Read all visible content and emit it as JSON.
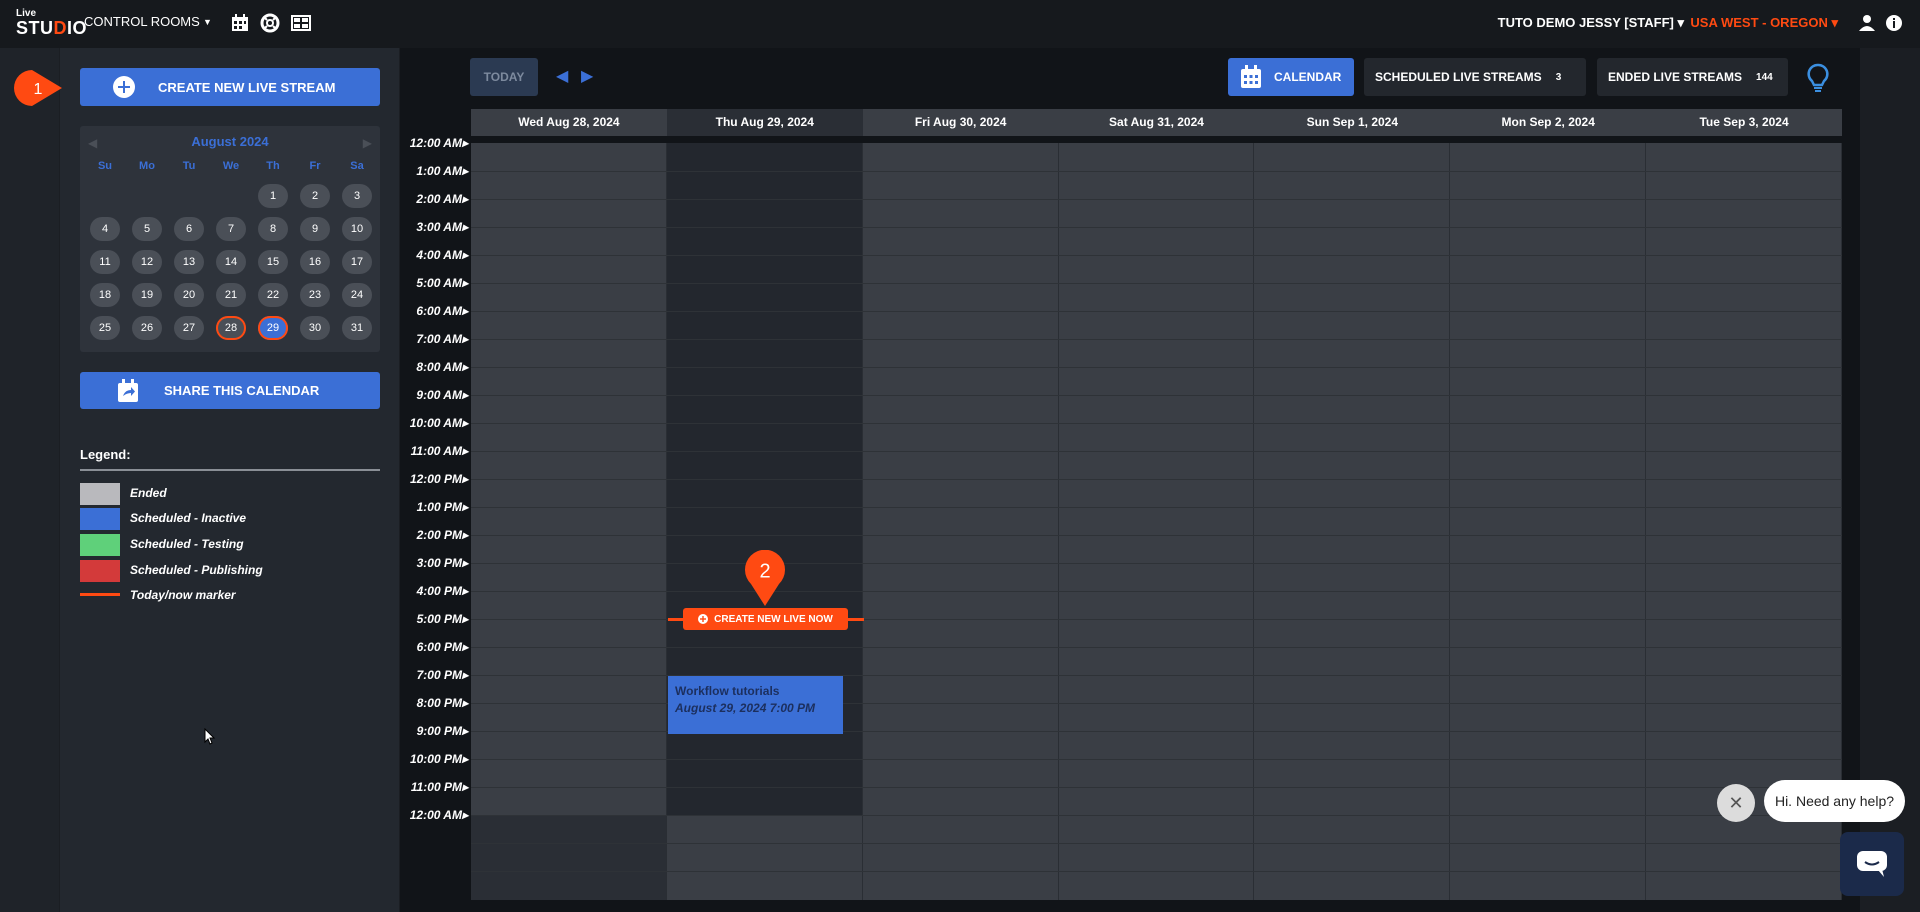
{
  "app": {
    "logo_top": "Live",
    "logo_main": "STU",
    "logo_dot": "D",
    "logo_end": "IO"
  },
  "topbar": {
    "control_rooms": "CONTROL ROOMS",
    "icons": [
      "calendar-icon",
      "lifebuoy-icon",
      "layout-icon"
    ],
    "user": "TUTO DEMO JESSY [STAFF] ▾",
    "region": "USA WEST - OREGON ▾"
  },
  "sidebar": {
    "create_button": "CREATE NEW LIVE STREAM",
    "marker_1": "1",
    "mini_calendar": {
      "month": "August 2024",
      "weekdays": [
        "Su",
        "Mo",
        "Tu",
        "We",
        "Th",
        "Fr",
        "Sa"
      ],
      "weeks": [
        [
          "",
          "",
          "",
          "",
          "1",
          "2",
          "3"
        ],
        [
          "4",
          "5",
          "6",
          "7",
          "8",
          "9",
          "10"
        ],
        [
          "11",
          "12",
          "13",
          "14",
          "15",
          "16",
          "17"
        ],
        [
          "18",
          "19",
          "20",
          "21",
          "22",
          "23",
          "24"
        ],
        [
          "25",
          "26",
          "27",
          "28",
          "29",
          "30",
          "31"
        ]
      ],
      "highlighted": "28",
      "selected": "29"
    },
    "share_button": "SHARE THIS CALENDAR",
    "legend": {
      "title": "Legend:",
      "items": [
        {
          "label": "Ended",
          "color": "#b9b9bd"
        },
        {
          "label": "Scheduled - Inactive",
          "color": "#3b6fd6"
        },
        {
          "label": "Scheduled - Testing",
          "color": "#5fd07a"
        },
        {
          "label": "Scheduled - Publishing",
          "color": "#d33a3a"
        },
        {
          "label": "Today/now marker",
          "color": "#ff4a12"
        }
      ]
    }
  },
  "toolbar": {
    "today": "TODAY",
    "calendar": "CALENDAR",
    "scheduled": "SCHEDULED LIVE STREAMS",
    "scheduled_count": "3",
    "ended": "ENDED LIVE STREAMS",
    "ended_count": "144"
  },
  "calendar": {
    "days": [
      "Wed Aug 28, 2024",
      "Thu Aug 29, 2024",
      "Fri Aug 30, 2024",
      "Sat Aug 31, 2024",
      "Sun Sep 1, 2024",
      "Mon Sep 2, 2024",
      "Tue Sep 3, 2024"
    ],
    "times": [
      "12:00 AM",
      "1:00 AM",
      "2:00 AM",
      "3:00 AM",
      "4:00 AM",
      "5:00 AM",
      "6:00 AM",
      "7:00 AM",
      "8:00 AM",
      "9:00 AM",
      "10:00 AM",
      "11:00 AM",
      "12:00 PM",
      "1:00 PM",
      "2:00 PM",
      "3:00 PM",
      "4:00 PM",
      "5:00 PM",
      "6:00 PM",
      "7:00 PM",
      "8:00 PM",
      "9:00 PM",
      "10:00 PM",
      "11:00 PM",
      "12:00 AM"
    ],
    "now_button": "CREATE NEW LIVE NOW",
    "marker_2": "2",
    "event": {
      "title": "Workflow tutorials",
      "date": "August 29, 2024 7:00 PM"
    }
  },
  "chat": {
    "message": "Hi. Need any help?"
  }
}
